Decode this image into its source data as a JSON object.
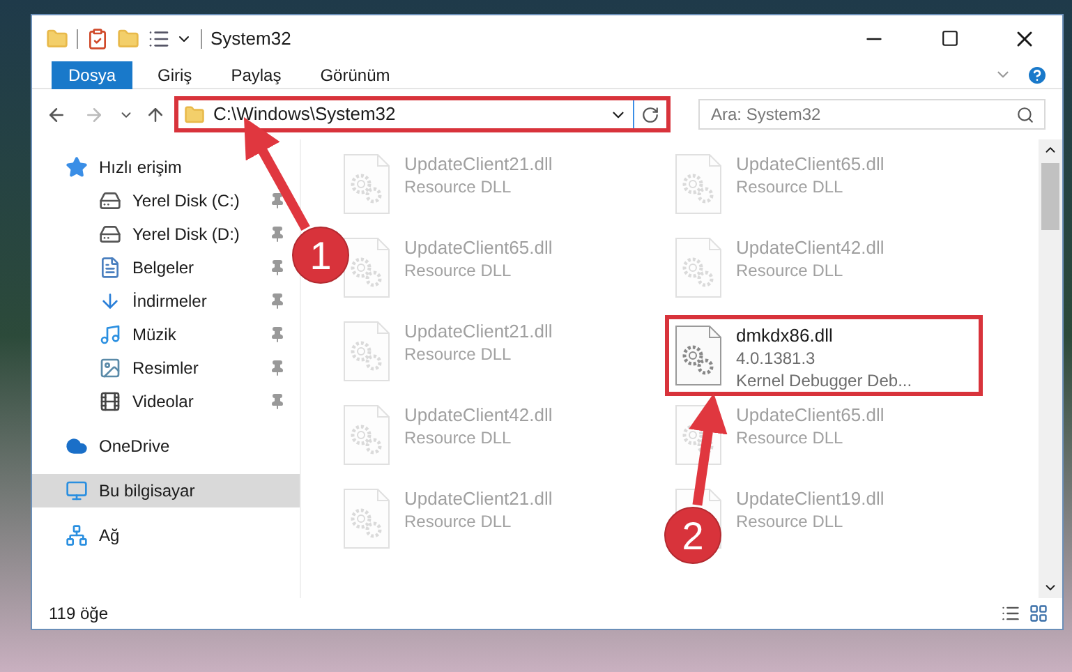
{
  "window": {
    "title": "System32"
  },
  "ribbon_tabs": [
    {
      "label": "Dosya",
      "selected": true
    },
    {
      "label": "Giriş",
      "selected": false
    },
    {
      "label": "Paylaş",
      "selected": false
    },
    {
      "label": "Görünüm",
      "selected": false
    }
  ],
  "address_bar": {
    "path": "C:\\Windows\\System32",
    "highlighted": true
  },
  "search": {
    "placeholder": "Ara: System32"
  },
  "sidebar": {
    "items": [
      {
        "label": "Hızlı erişim",
        "kind": "star",
        "pinned": false,
        "selected": false,
        "children": [
          {
            "label": "Yerel Disk (C:)",
            "kind": "drive",
            "pinned": true,
            "selected": false
          },
          {
            "label": "Yerel Disk (D:)",
            "kind": "drive",
            "pinned": true,
            "selected": false
          },
          {
            "label": "Belgeler",
            "kind": "documents",
            "pinned": true,
            "selected": false
          },
          {
            "label": "İndirmeler",
            "kind": "downloads",
            "pinned": true,
            "selected": false
          },
          {
            "label": "Müzik",
            "kind": "music",
            "pinned": true,
            "selected": false
          },
          {
            "label": "Resimler",
            "kind": "pictures",
            "pinned": true,
            "selected": false
          },
          {
            "label": "Videolar",
            "kind": "videos",
            "pinned": true,
            "selected": false
          }
        ]
      },
      {
        "label": "OneDrive",
        "kind": "cloud",
        "pinned": false,
        "selected": false
      },
      {
        "label": "Bu bilgisayar",
        "kind": "computer",
        "pinned": false,
        "selected": true
      },
      {
        "label": "Ağ",
        "kind": "network",
        "pinned": false,
        "selected": false
      }
    ]
  },
  "files": [
    {
      "name": "UpdateClient21.dll",
      "lines": [
        "Resource DLL"
      ],
      "dimmed": true,
      "highlighted": false
    },
    {
      "name": "UpdateClient65.dll",
      "lines": [
        "Resource DLL"
      ],
      "dimmed": true,
      "highlighted": false
    },
    {
      "name": "UpdateClient65.dll",
      "lines": [
        "Resource DLL"
      ],
      "dimmed": true,
      "highlighted": false
    },
    {
      "name": "UpdateClient42.dll",
      "lines": [
        "Resource DLL"
      ],
      "dimmed": true,
      "highlighted": false
    },
    {
      "name": "UpdateClient21.dll",
      "lines": [
        "Resource DLL"
      ],
      "dimmed": true,
      "highlighted": false
    },
    {
      "name": "dmkdx86.dll",
      "lines": [
        "4.0.1381.3",
        "Kernel Debugger Deb..."
      ],
      "dimmed": false,
      "highlighted": true
    },
    {
      "name": "UpdateClient42.dll",
      "lines": [
        "Resource DLL"
      ],
      "dimmed": true,
      "highlighted": false
    },
    {
      "name": "UpdateClient65.dll",
      "lines": [
        "Resource DLL"
      ],
      "dimmed": true,
      "highlighted": false
    },
    {
      "name": "UpdateClient21.dll",
      "lines": [
        "Resource DLL"
      ],
      "dimmed": true,
      "highlighted": false
    },
    {
      "name": "UpdateClient19.dll",
      "lines": [
        "Resource DLL"
      ],
      "dimmed": true,
      "highlighted": false
    }
  ],
  "status_bar": {
    "count": "119 öğe"
  },
  "annotations": [
    {
      "number": "1"
    },
    {
      "number": "2"
    }
  ]
}
